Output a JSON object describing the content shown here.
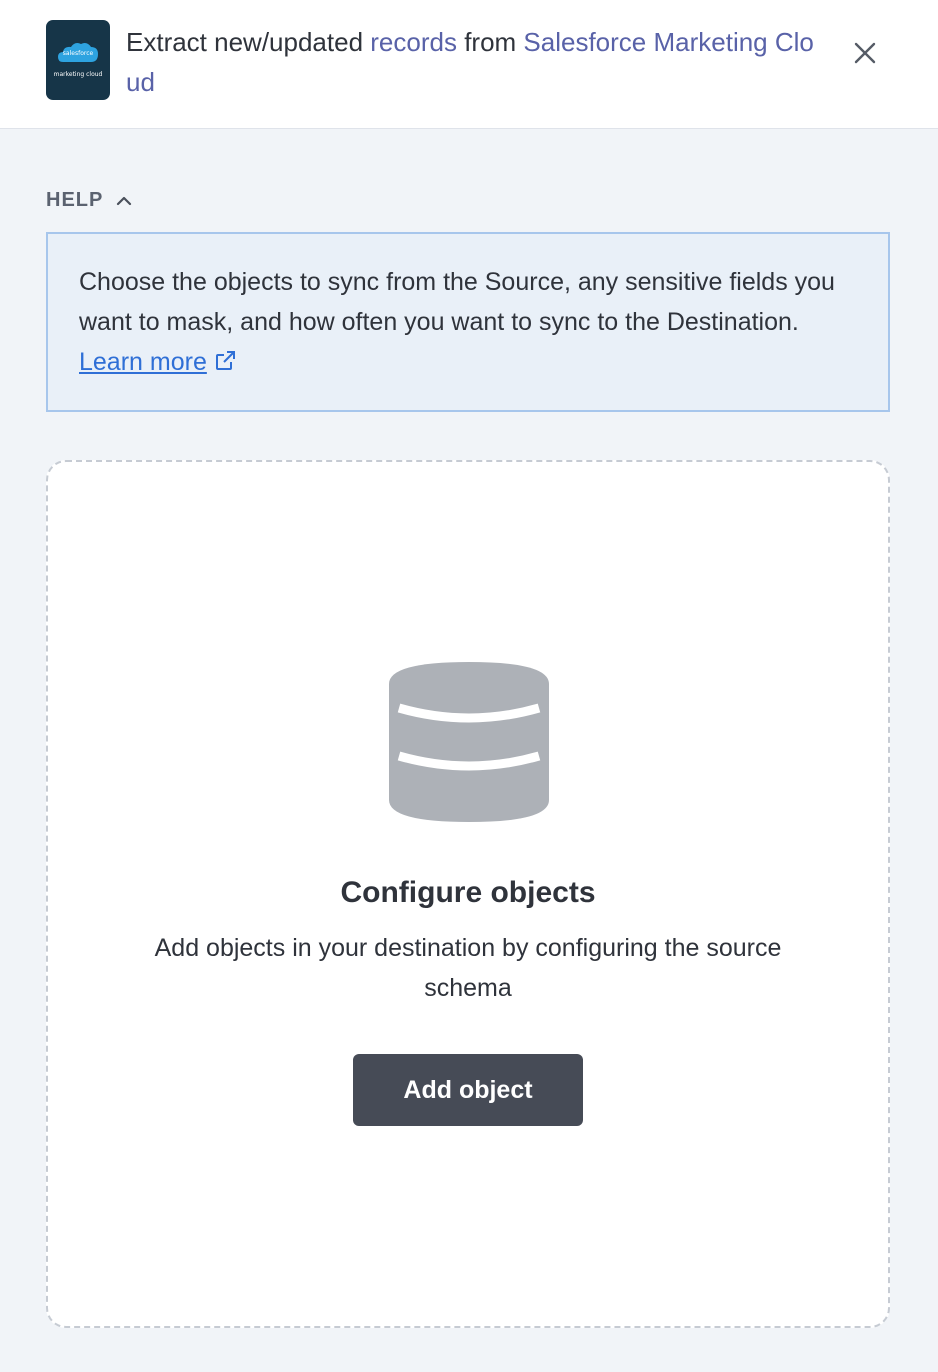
{
  "header": {
    "logo_brand": "salesforce",
    "logo_product": "marketing cloud",
    "title_prefix": "Extract new/updated ",
    "title_records": "records",
    "title_middle": " from ",
    "title_source": "Salesforce Marketing Cloud"
  },
  "help": {
    "toggle_label": "HELP",
    "text": "Choose the objects to sync from the Source, any sensitive fields you want to mask, and how often you want to sync to the Destination. ",
    "link_label": "Learn more"
  },
  "empty_state": {
    "title": "Configure objects",
    "description": "Add objects in your destination by configuring the source schema",
    "button_label": "Add object"
  },
  "colors": {
    "accent_link": "#5962a8",
    "help_link": "#2f6fd6",
    "button_bg": "#464b56"
  }
}
